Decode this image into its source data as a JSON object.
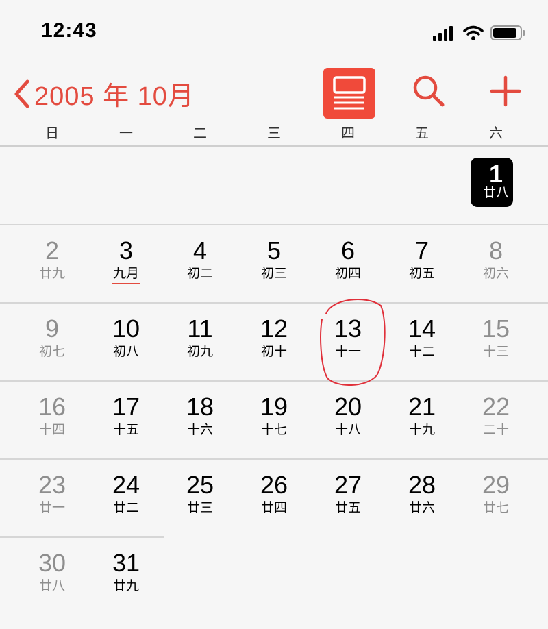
{
  "status_bar": {
    "time": "12:43"
  },
  "nav": {
    "title": "2005 年 10月"
  },
  "colors": {
    "accent": "#e34b3f",
    "today_bg": "#000000",
    "list_button_bg": "#f04a3a"
  },
  "icons": [
    "chevron-left-icon",
    "list-view-icon",
    "search-icon",
    "plus-icon",
    "signal-icon",
    "wifi-icon",
    "battery-icon"
  ],
  "weekdays": [
    "日",
    "一",
    "二",
    "三",
    "四",
    "五",
    "六"
  ],
  "weeks": [
    [
      null,
      null,
      null,
      null,
      null,
      null,
      {
        "d": "1",
        "l": "廿八",
        "today": true
      }
    ],
    [
      {
        "d": "2",
        "l": "廿九",
        "dim": true
      },
      {
        "d": "3",
        "l": "九月",
        "month_start": true
      },
      {
        "d": "4",
        "l": "初二"
      },
      {
        "d": "5",
        "l": "初三"
      },
      {
        "d": "6",
        "l": "初四"
      },
      {
        "d": "7",
        "l": "初五"
      },
      {
        "d": "8",
        "l": "初六",
        "dim": true
      }
    ],
    [
      {
        "d": "9",
        "l": "初七",
        "dim": true
      },
      {
        "d": "10",
        "l": "初八"
      },
      {
        "d": "11",
        "l": "初九"
      },
      {
        "d": "12",
        "l": "初十"
      },
      {
        "d": "13",
        "l": "十一",
        "circled": true
      },
      {
        "d": "14",
        "l": "十二"
      },
      {
        "d": "15",
        "l": "十三",
        "dim": true
      }
    ],
    [
      {
        "d": "16",
        "l": "十四",
        "dim": true
      },
      {
        "d": "17",
        "l": "十五"
      },
      {
        "d": "18",
        "l": "十六"
      },
      {
        "d": "19",
        "l": "十七"
      },
      {
        "d": "20",
        "l": "十八"
      },
      {
        "d": "21",
        "l": "十九"
      },
      {
        "d": "22",
        "l": "二十",
        "dim": true
      }
    ],
    [
      {
        "d": "23",
        "l": "廿一",
        "dim": true
      },
      {
        "d": "24",
        "l": "廿二"
      },
      {
        "d": "25",
        "l": "廿三"
      },
      {
        "d": "26",
        "l": "廿四"
      },
      {
        "d": "27",
        "l": "廿五"
      },
      {
        "d": "28",
        "l": "廿六"
      },
      {
        "d": "29",
        "l": "廿七",
        "dim": true
      }
    ],
    [
      {
        "d": "30",
        "l": "廿八",
        "dim": true
      },
      {
        "d": "31",
        "l": "廿九"
      },
      null,
      null,
      null,
      null,
      null
    ]
  ]
}
